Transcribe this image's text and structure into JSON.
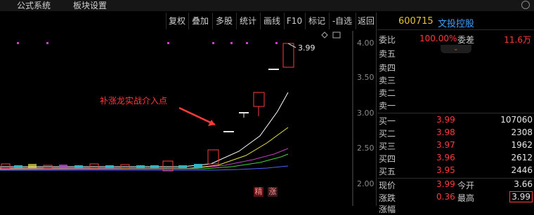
{
  "menu": {
    "item1": "公式系统",
    "item2": "板块设置"
  },
  "toolbar": [
    "复权",
    "叠加",
    "多股",
    "统计",
    "画线",
    "F10",
    "标记",
    "-自选",
    "返回"
  ],
  "chart": {
    "y_ticks": [
      "4.00",
      "3.50",
      "3.00",
      "2.50",
      "2.00"
    ],
    "last_price_label": "3.99",
    "annotation": "补涨龙实战介入点",
    "badge1": "精",
    "badge2": "涨",
    "colors": {
      "up": "#ff3a3a",
      "annotation": "#ff3a3a",
      "axis": "#8a8a8a"
    }
  },
  "quote": {
    "code": "600715",
    "name": "文投控股",
    "ratio_label": "委比",
    "ratio_value": "100.00%",
    "diff_label": "委差",
    "diff_value": "11.6万",
    "sell": [
      {
        "label": "卖五"
      },
      {
        "label": "卖四"
      },
      {
        "label": "卖三"
      },
      {
        "label": "卖二"
      },
      {
        "label": "卖一"
      }
    ],
    "buy": [
      {
        "label": "买一",
        "price": "3.99",
        "vol": "107060"
      },
      {
        "label": "买二",
        "price": "3.98",
        "vol": "2308"
      },
      {
        "label": "买三",
        "price": "3.97",
        "vol": "1962"
      },
      {
        "label": "买四",
        "price": "3.96",
        "vol": "2612"
      },
      {
        "label": "买五",
        "price": "3.95",
        "vol": "2446"
      }
    ],
    "stats": {
      "now_label": "现价",
      "now_value": "3.99",
      "open_label": "今开",
      "open_value": "3.66",
      "chg_label": "涨跌",
      "chg_value": "0.36",
      "high_label": "最高",
      "high_value": "3.99",
      "amp_label": "涨幅"
    }
  }
}
